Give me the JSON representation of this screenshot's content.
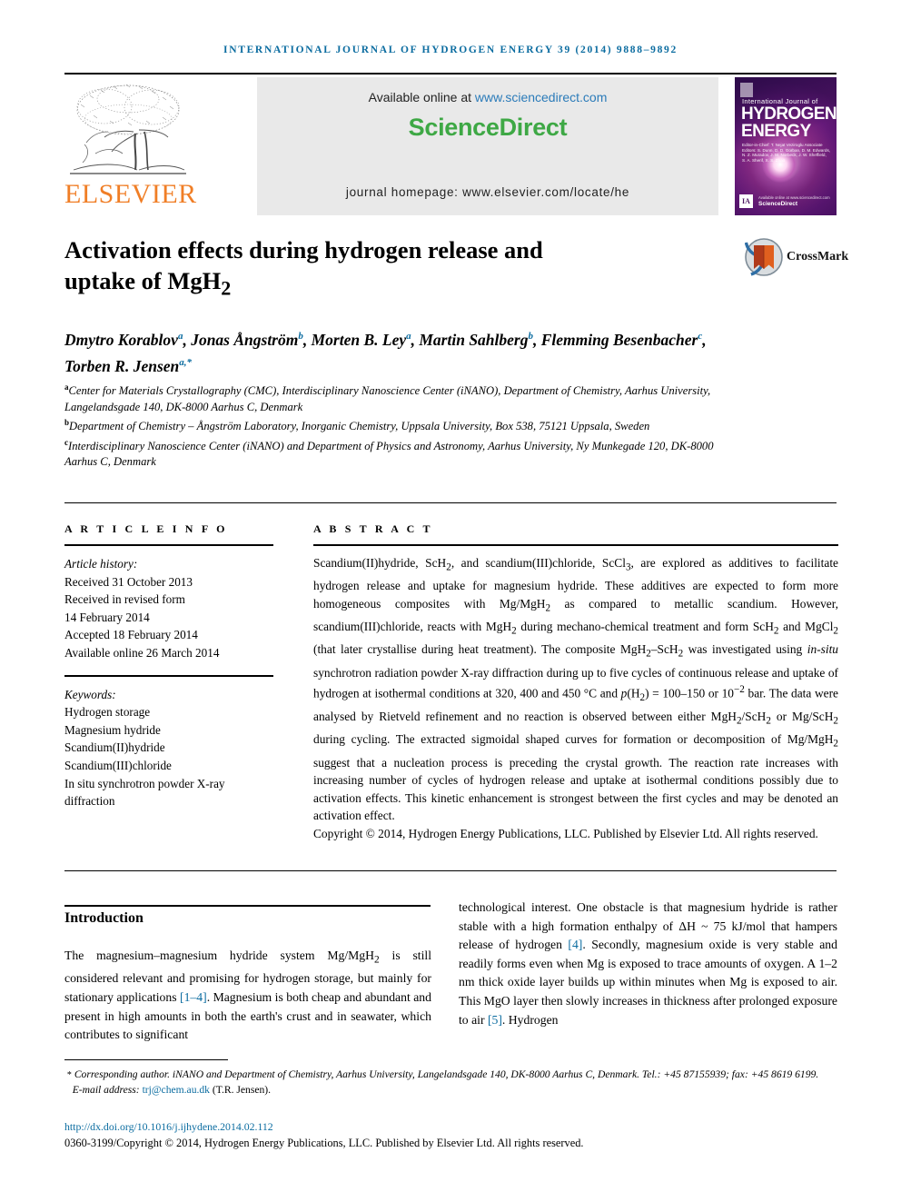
{
  "running_head": "INTERNATIONAL JOURNAL OF HYDROGEN ENERGY 39 (2014) 9888–9892",
  "masthead": {
    "publisher_name": "ELSEVIER",
    "available_prefix": "Available online at ",
    "available_url": "www.sciencedirect.com",
    "sciencedirect_logo": "ScienceDirect",
    "journal_homepage": "journal homepage: www.elsevier.com/locate/he",
    "cover": {
      "line_small": "International Journal of",
      "line_big_1": "HYDROGEN",
      "line_big_2": "ENERGY",
      "editors": "Editor-in-Chief: T. Nejat Veziroglu    Associate Editors: S. Dunn, D. D. Gorban, D. M. Edwards, N. Z. Muradov, J. M. Norbeck, J. W. Sheffield, S. A. Sherif, X. S. Zhao",
      "sciencedirect_badge": "ScienceDirect",
      "badge_note": "Available online at www.sciencedirect.com",
      "badge_glyph": "IA"
    }
  },
  "article": {
    "title_line_1": "Activation effects during hydrogen release and",
    "title_line_2_pre": "uptake of MgH",
    "title_line_2_sub": "2",
    "crossmark_label": "CrossMark"
  },
  "authors": [
    {
      "name": "Dmytro Korablov",
      "marks": "a",
      "sep": ", "
    },
    {
      "name": "Jonas Ångström",
      "marks": "b",
      "sep": ", "
    },
    {
      "name": "Morten B. Ley",
      "marks": "a",
      "sep": ", "
    },
    {
      "name": "Martin Sahlberg",
      "marks": "b",
      "sep": ", "
    },
    {
      "name": "Flemming Besenbacher",
      "marks": "c",
      "sep": ", "
    },
    {
      "name": "Torben R. Jensen",
      "marks": "a,*",
      "sep": ""
    }
  ],
  "affiliations": [
    {
      "mark": "a",
      "text": "Center for Materials Crystallography (CMC), Interdisciplinary Nanoscience Center (iNANO), Department of Chemistry, Aarhus University, Langelandsgade 140, DK-8000 Aarhus C, Denmark"
    },
    {
      "mark": "b",
      "text": "Department of Chemistry – Ångström Laboratory, Inorganic Chemistry, Uppsala University, Box 538, 75121 Uppsala, Sweden"
    },
    {
      "mark": "c",
      "text": "Interdisciplinary Nanoscience Center (iNANO) and Department of Physics and Astronomy, Aarhus University, Ny Munkegade 120, DK-8000 Aarhus C, Denmark"
    }
  ],
  "article_info": {
    "heading": "A R T I C L E   I N F O",
    "history_label": "Article history:",
    "history": [
      "Received 31 October 2013",
      "Received in revised form",
      "14 February 2014",
      "Accepted 18 February 2014",
      "Available online 26 March 2014"
    ],
    "keywords_label": "Keywords:",
    "keywords": [
      "Hydrogen storage",
      "Magnesium hydride",
      "Scandium(II)hydride",
      "Scandium(III)chloride",
      "In situ synchrotron powder X-ray",
      "diffraction"
    ]
  },
  "abstract": {
    "heading": "A B S T R A C T",
    "body": "Scandium(II)hydride, ScH2, and scandium(III)chloride, ScCl3, are explored as additives to facilitate hydrogen release and uptake for magnesium hydride. These additives are expected to form more homogeneous composites with Mg/MgH2 as compared to metallic scandium. However, scandium(III)chloride, reacts with MgH2 during mechano-chemical treatment and form ScH2 and MgCl2 (that later crystallise during heat treatment). The composite MgH2–ScH2 was investigated using in-situ synchrotron radiation powder X-ray diffraction during up to five cycles of continuous release and uptake of hydrogen at isothermal conditions at 320, 400 and 450 °C and p(H2) = 100–150 or 10-2 bar. The data were analysed by Rietveld refinement and no reaction is observed between either MgH2/ScH2 or Mg/ScH2 during cycling. The extracted sigmoidal shaped curves for formation or decomposition of Mg/MgH2 suggest that a nucleation process is preceding the crystal growth. The reaction rate increases with increasing number of cycles of hydrogen release and uptake at isothermal conditions possibly due to activation effects. This kinetic enhancement is strongest between the first cycles and may be denoted an activation effect.",
    "copyright": "Copyright © 2014, Hydrogen Energy Publications, LLC. Published by Elsevier Ltd. All rights reserved."
  },
  "introduction": {
    "heading": "Introduction",
    "left_text": "The magnesium–magnesium hydride system Mg/MgH2 is still considered relevant and promising for hydrogen storage, but mainly for stationary applications [1–4]. Magnesium is both cheap and abundant and present in high amounts in both the earth's crust and in seawater, which contributes to significant",
    "right_text": "technological interest. One obstacle is that magnesium hydride is rather stable with a high formation enthalpy of ΔH ~ 75 kJ/mol that hampers release of hydrogen [4]. Secondly, magnesium oxide is very stable and readily forms even when Mg is exposed to trace amounts of oxygen. A 1–2 nm thick oxide layer builds up within minutes when Mg is exposed to air. This MgO layer then slowly increases in thickness after prolonged exposure to air [5]. Hydrogen"
  },
  "footnote": {
    "corresponding": "Corresponding author. iNANO and Department of Chemistry, Aarhus University, Langelandsgade 140, DK-8000 Aarhus C, Denmark. Tel.: +45 87155939; fax: +45 8619 6199.",
    "email_label": "E-mail address: ",
    "email": "trj@chem.au.dk",
    "email_owner": " (T.R. Jensen).",
    "doi": "http://dx.doi.org/10.1016/j.ijhydene.2014.02.112",
    "issn_line": "0360-3199/Copyright © 2014, Hydrogen Energy Publications, LLC. Published by Elsevier Ltd. All rights reserved."
  },
  "colors": {
    "link_blue": "#0b6ca0",
    "elsevier_orange": "#F07E26",
    "sciencedirect_green": "#3EA845",
    "banner_gray": "#e9e9e9"
  }
}
